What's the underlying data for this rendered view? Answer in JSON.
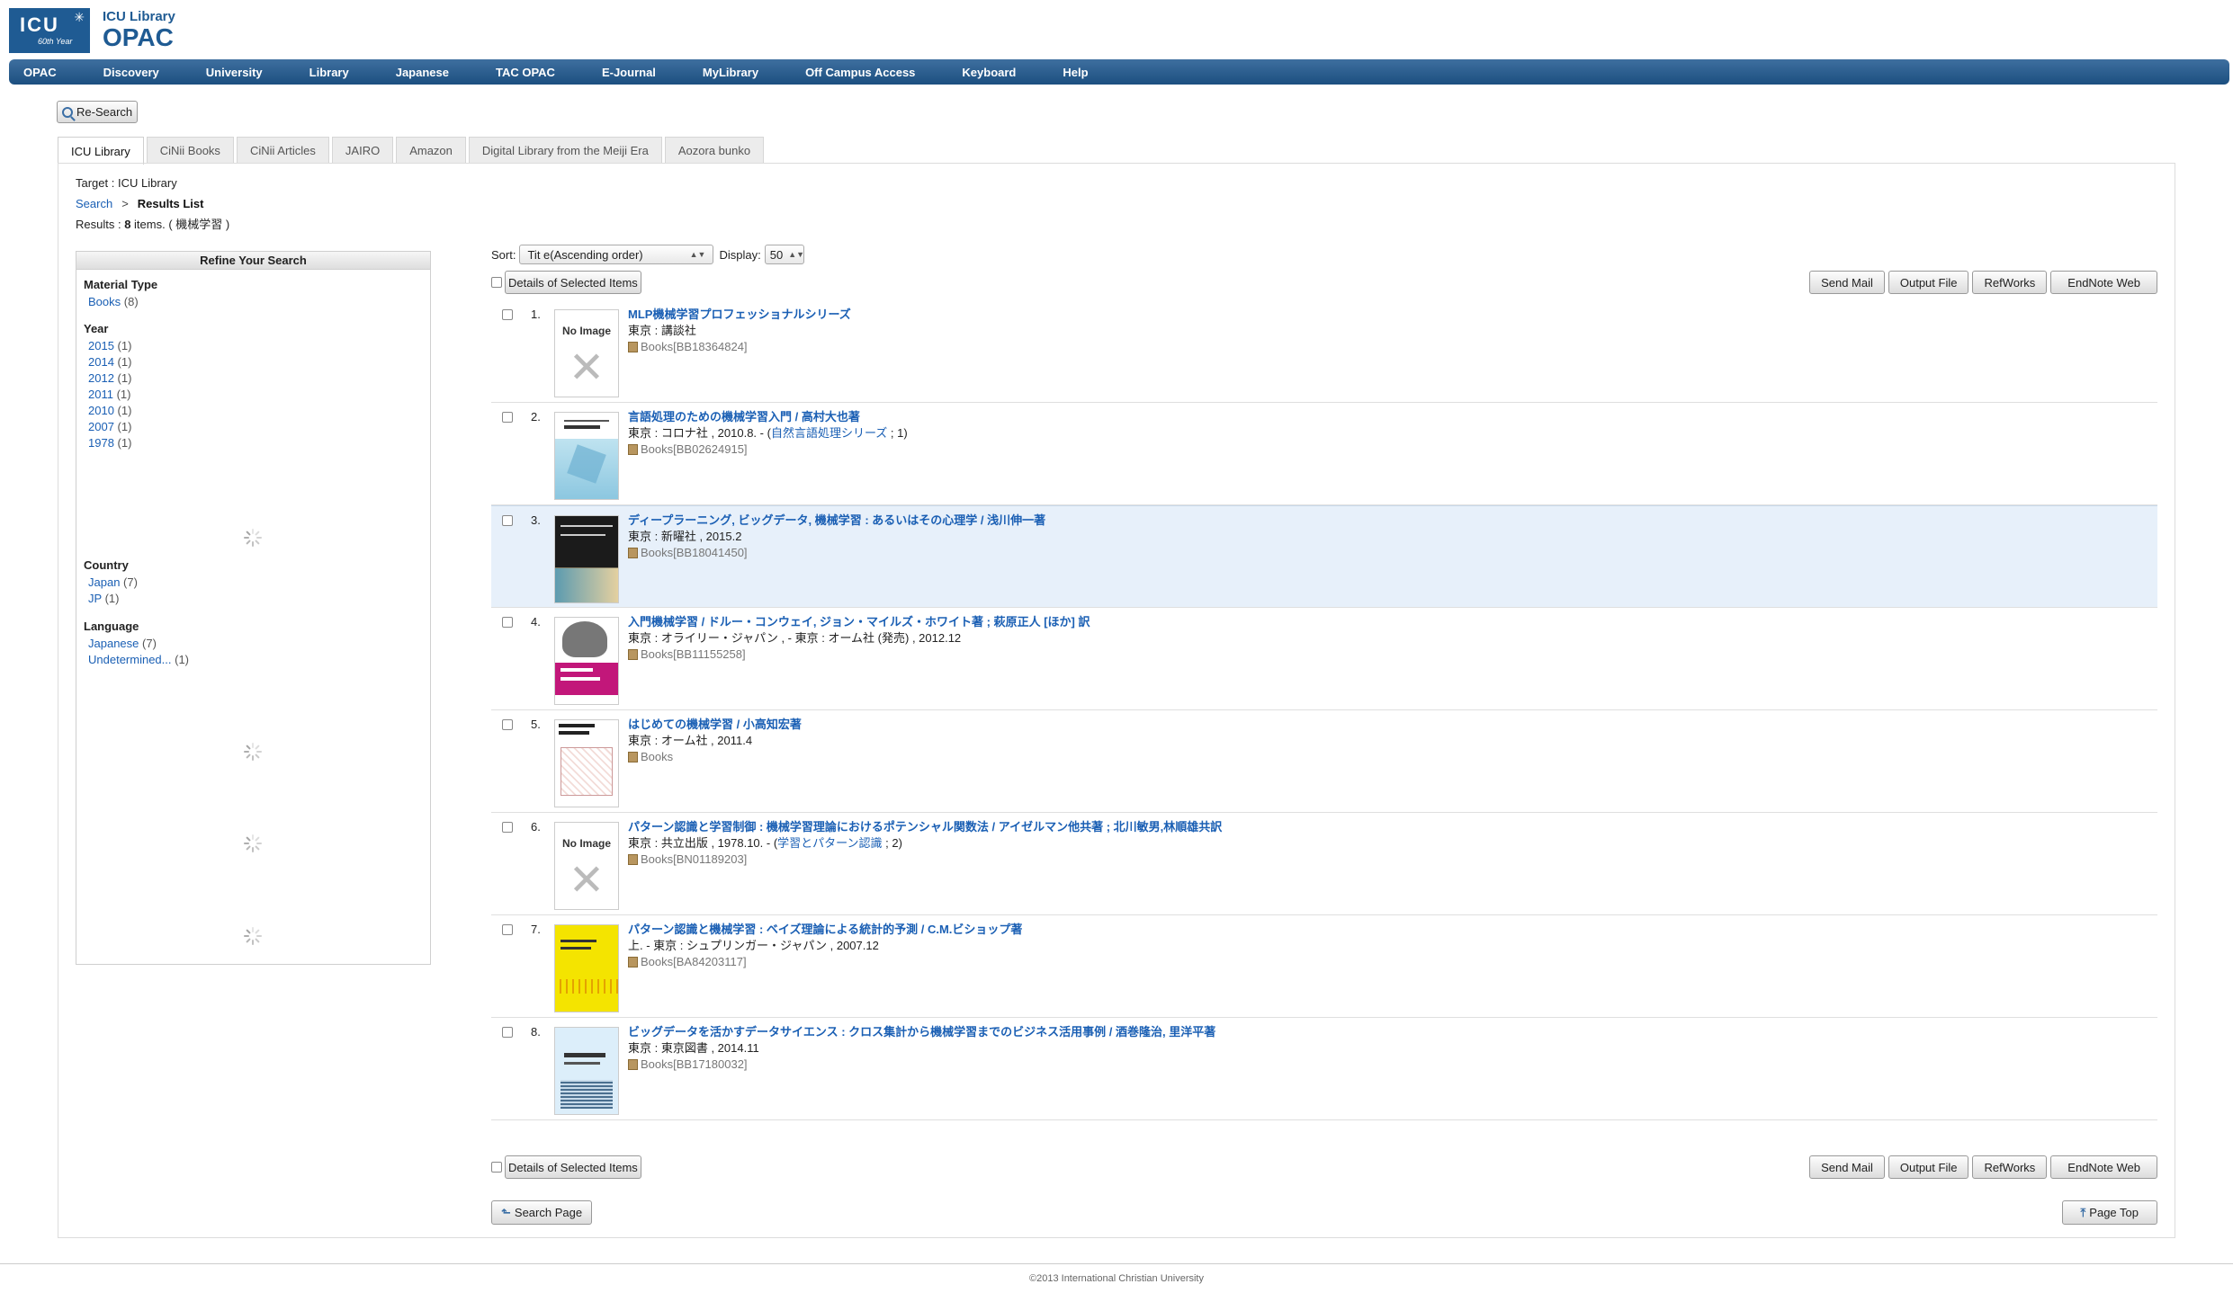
{
  "header": {
    "logo_text": "ICU",
    "logo_sub": "60th Year",
    "brand_line1": "ICU Library",
    "brand_line2": "OPAC"
  },
  "nav": [
    "OPAC",
    "Discovery",
    "University",
    "Library",
    "Japanese",
    "TAC OPAC",
    "E-Journal",
    "MyLibrary",
    "Off Campus Access",
    "Keyboard",
    "Help"
  ],
  "re_search_label": "Re-Search",
  "tabs": [
    {
      "label": "ICU Library",
      "active": true
    },
    {
      "label": "CiNii Books"
    },
    {
      "label": "CiNii Articles"
    },
    {
      "label": "JAIRO"
    },
    {
      "label": "Amazon"
    },
    {
      "label": "Digital Library from the Meiji Era"
    },
    {
      "label": "Aozora bunko"
    }
  ],
  "target_text": "Target : ICU Library",
  "breadcrumb": {
    "search": "Search",
    "sep": ">",
    "current": "Results List"
  },
  "results_summary": {
    "prefix": "Results : ",
    "count": "8",
    "suffix": " items. ( 機械学習 )"
  },
  "refine": {
    "title": "Refine Your Search",
    "material_type": {
      "heading": "Material Type",
      "items": [
        {
          "label": "Books",
          "count": "(8)"
        }
      ]
    },
    "year": {
      "heading": "Year",
      "items": [
        {
          "label": "2015",
          "count": "(1)"
        },
        {
          "label": "2014",
          "count": "(1)"
        },
        {
          "label": "2012",
          "count": "(1)"
        },
        {
          "label": "2011",
          "count": "(1)"
        },
        {
          "label": "2010",
          "count": "(1)"
        },
        {
          "label": "2007",
          "count": "(1)"
        },
        {
          "label": "1978",
          "count": "(1)"
        }
      ]
    },
    "country": {
      "heading": "Country",
      "items": [
        {
          "label": "Japan",
          "count": "(7)"
        },
        {
          "label": "JP",
          "count": "(1)"
        }
      ]
    },
    "language": {
      "heading": "Language",
      "items": [
        {
          "label": "Japanese",
          "count": "(7)"
        },
        {
          "label": "Undetermined...",
          "count": "(1)"
        }
      ]
    }
  },
  "sort": {
    "label": "Sort:",
    "value": "Tit e(Ascending order)",
    "display_label": "Display:",
    "display_value": "50"
  },
  "actions": {
    "details": "Details of Selected Items",
    "send_mail": "Send Mail",
    "output_file": "Output File",
    "refworks": "RefWorks",
    "endnote": "EndNote Web"
  },
  "no_image_label": "No Image",
  "results": [
    {
      "num": "1.",
      "title": "MLP機械学習プロフェッショナルシリーズ",
      "pub": "東京 : 講談社",
      "series": "",
      "series_tail": "",
      "bib": "Books[BB18364824]",
      "cover": "none"
    },
    {
      "num": "2.",
      "title": "言語処理のための機械学習入門 / 高村大也著",
      "pub": "東京 : コロナ社 , 2010.8. - (",
      "series": "自然言語処理シリーズ",
      "series_tail": " ; 1)",
      "bib": "Books[BB02624915]",
      "cover": "blue"
    },
    {
      "num": "3.",
      "title": "ディープラーニング, ビッグデータ, 機械学習 : あるいはその心理学 / 浅川伸一著",
      "pub": "東京 : 新曜社 , 2015.2",
      "series": "",
      "series_tail": "",
      "bib": "Books[BB18041450]",
      "cover": "dark"
    },
    {
      "num": "4.",
      "title": "入門機械学習 / ドルー・コンウェイ, ジョン・マイルズ・ホワイト著 ; 萩原正人 [ほか] 訳",
      "pub": "東京 : オライリー・ジャパン , - 東京 : オーム社 (発売) , 2012.12",
      "series": "",
      "series_tail": "",
      "bib": "Books[BB11155258]",
      "cover": "oreilly"
    },
    {
      "num": "5.",
      "title": "はじめての機械学習 / 小高知宏著",
      "pub": "東京 : オーム社 , 2011.4",
      "series": "",
      "series_tail": "",
      "bib": "Books",
      "cover": "sketch"
    },
    {
      "num": "6.",
      "title": "パターン認識と学習制御 : 機械学習理論におけるポテンシャル関数法 / アイゼルマン他共著 ; 北川敏男,林順雄共訳",
      "pub": "東京 : 共立出版 , 1978.10. - (",
      "series": "学習とパターン認識",
      "series_tail": " ; 2)",
      "bib": "Books[BN01189203]",
      "cover": "none"
    },
    {
      "num": "7.",
      "title": "パターン認識と機械学習 : ベイズ理論による統計的予測 / C.M.ビショップ著",
      "pub": "上. - 東京 : シュプリンガー・ジャパン , 2007.12",
      "series": "",
      "series_tail": "",
      "bib": "Books[BA84203117]",
      "cover": "yellow"
    },
    {
      "num": "8.",
      "title": "ビッグデータを活かすデータサイエンス : クロス集計から機械学習までのビジネス活用事例 / 酒巻隆治, 里洋平著",
      "pub": "東京 : 東京図書 , 2014.11",
      "series": "",
      "series_tail": "",
      "bib": "Books[BB17180032]",
      "cover": "lightblue"
    }
  ],
  "search_page_label": "Search Page",
  "page_top_label": "Page Top",
  "footer": "©2013 International Christian University"
}
